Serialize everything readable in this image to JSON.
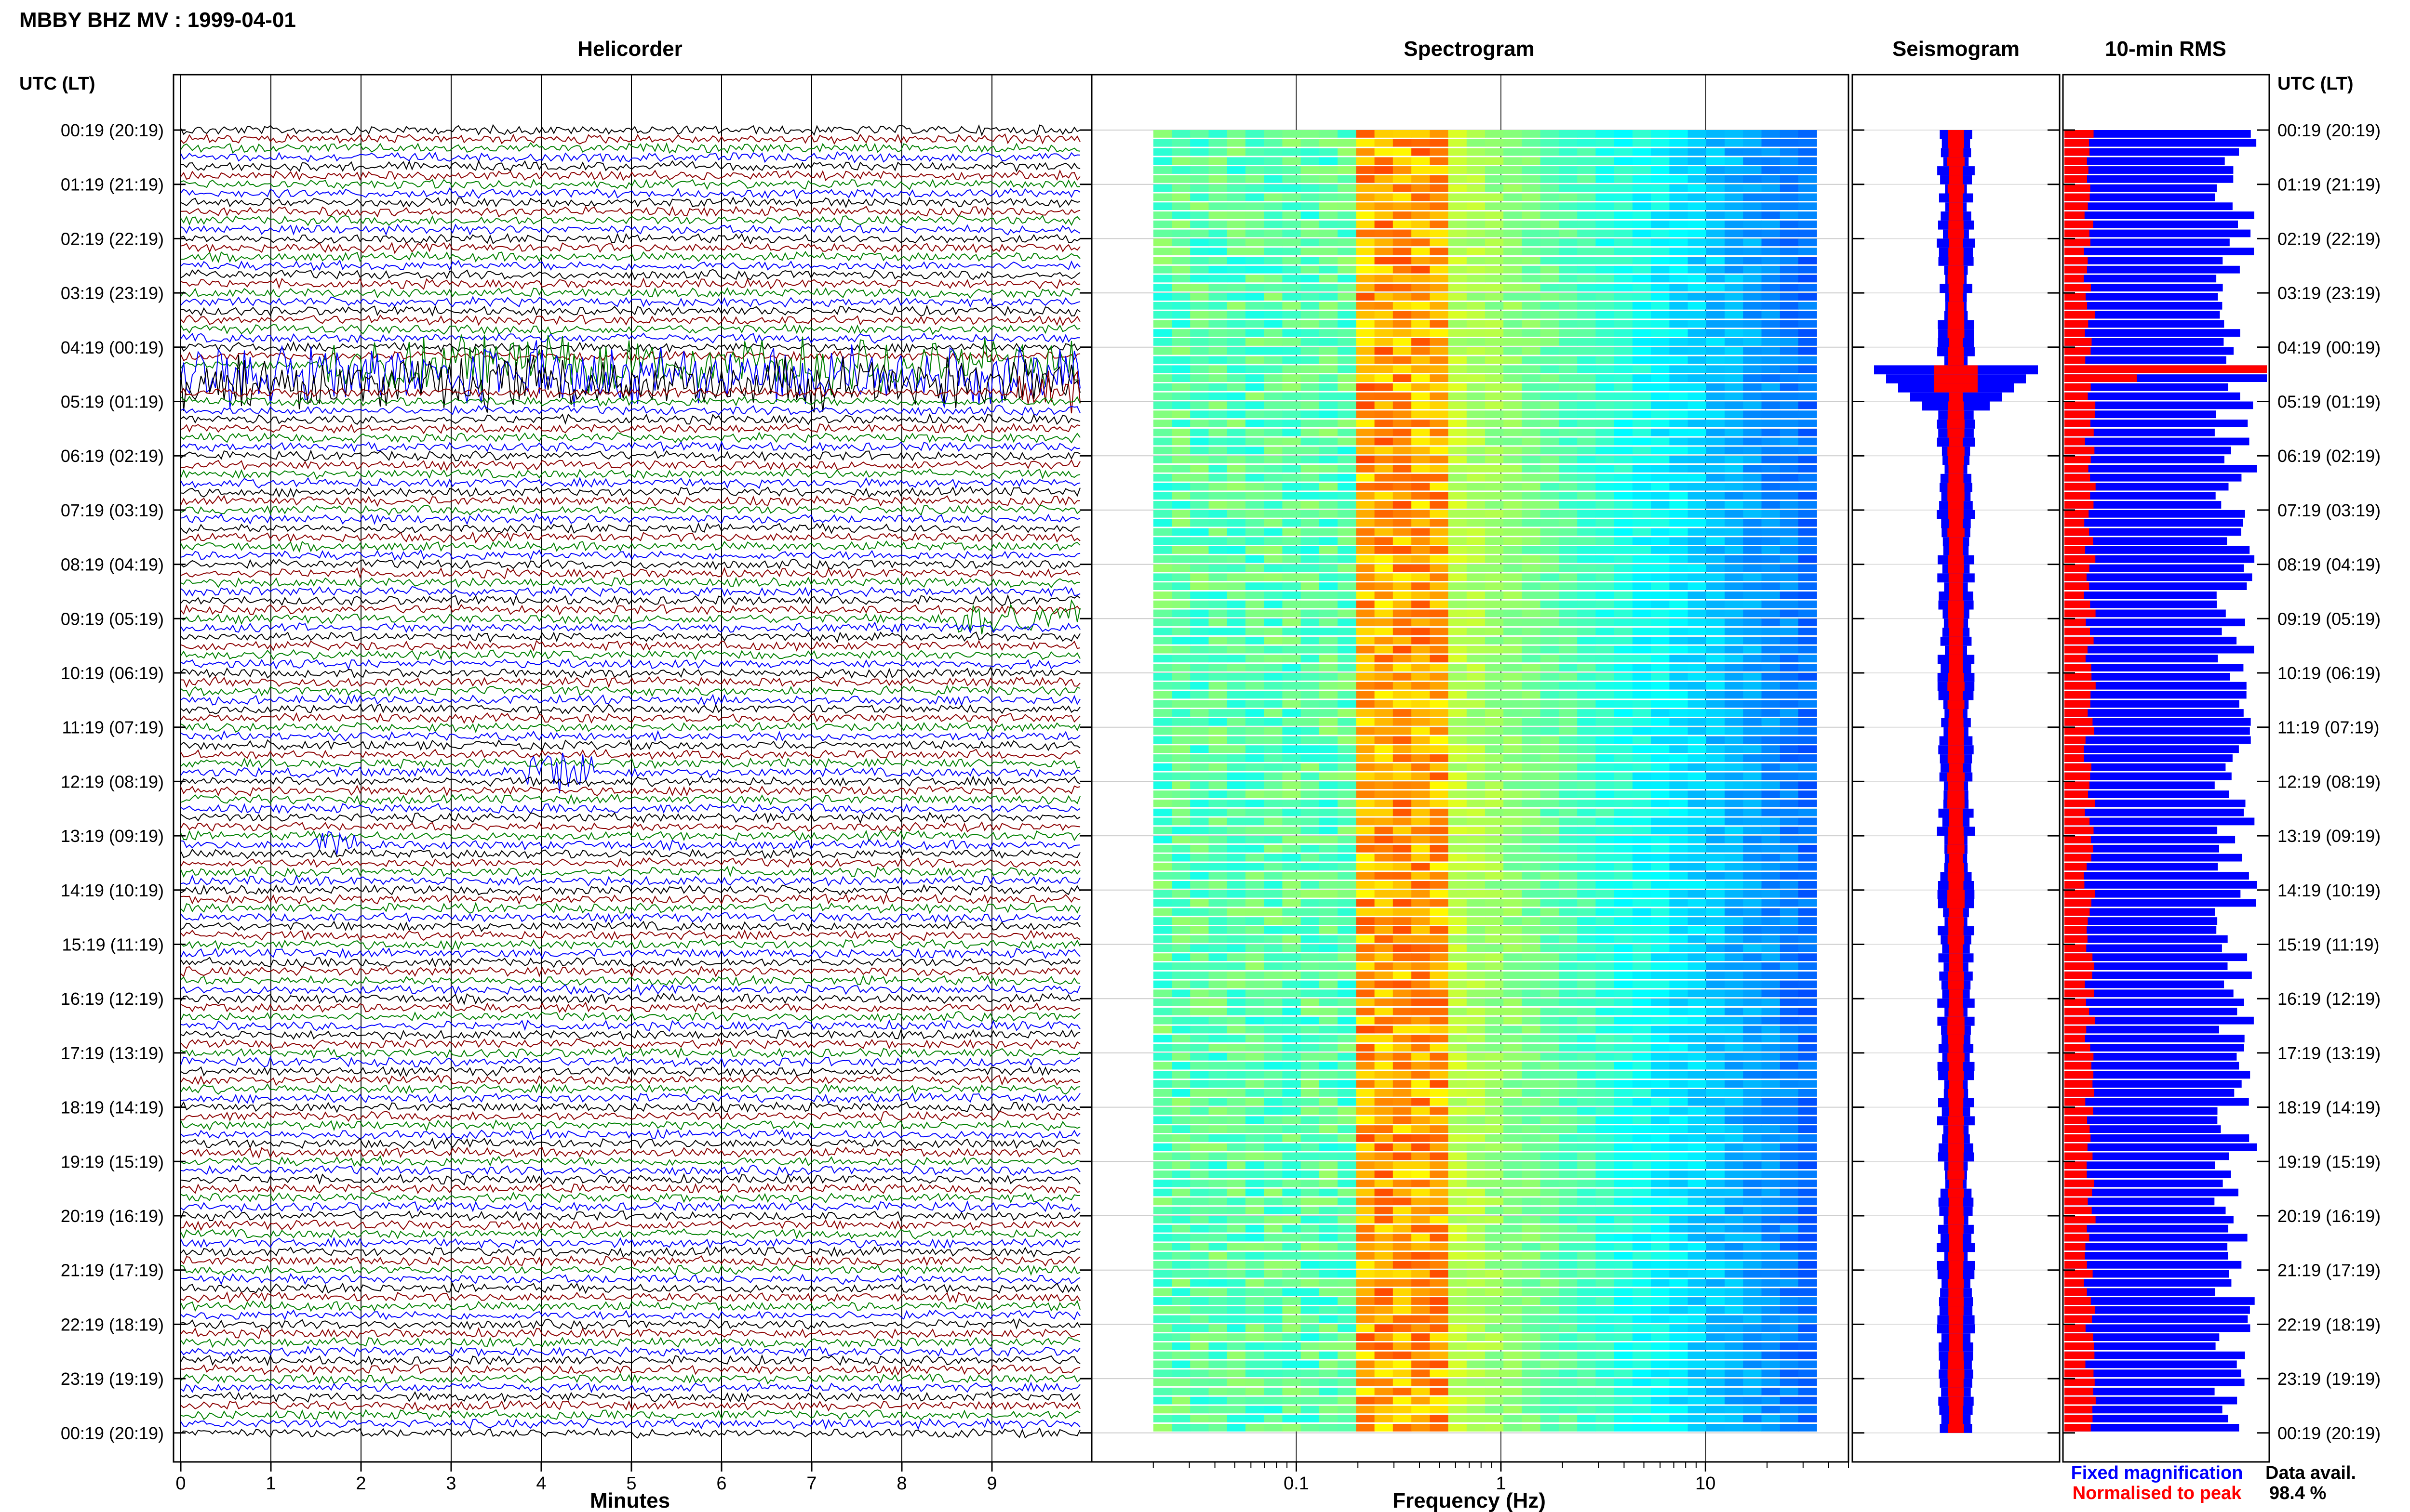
{
  "page_title": "MBBY BHZ MV : 1999-04-01",
  "time_axis_label": "UTC (LT)",
  "row_labels": [
    "00:19 (20:19)",
    "01:19 (21:19)",
    "02:19 (22:19)",
    "03:19 (23:19)",
    "04:19 (00:19)",
    "05:19 (01:19)",
    "06:19 (02:19)",
    "07:19 (03:19)",
    "08:19 (04:19)",
    "09:19 (05:19)",
    "10:19 (06:19)",
    "11:19 (07:19)",
    "12:19 (08:19)",
    "13:19 (09:19)",
    "14:19 (10:19)",
    "15:19 (11:19)",
    "16:19 (12:19)",
    "17:19 (13:19)",
    "18:19 (14:19)",
    "19:19 (15:19)",
    "20:19 (16:19)",
    "21:19 (17:19)",
    "22:19 (18:19)",
    "23:19 (19:19)",
    "00:19 (20:19)"
  ],
  "chart_data": [
    {
      "type": "line",
      "title": "Helicorder",
      "xlabel": "Minutes",
      "x_ticks": [
        0,
        1,
        2,
        3,
        4,
        5,
        6,
        7,
        8,
        9
      ],
      "xlim": [
        0,
        10
      ],
      "trace_colors": [
        "#000000",
        "#8b0000",
        "#008000",
        "#0000ff"
      ],
      "lines_per_hour": 6,
      "events": [
        {
          "row": 26,
          "start_min": 1.6,
          "end_min": 10.0,
          "level": 0.9
        },
        {
          "row": 27,
          "start_min": 0.0,
          "end_min": 10.0,
          "level": 1.0
        },
        {
          "row": 28,
          "start_min": 0.0,
          "end_min": 10.0,
          "level": 0.8
        },
        {
          "row": 29,
          "start_min": 9.3,
          "end_min": 10.0,
          "level": 0.6
        },
        {
          "row": 54,
          "start_min": 8.6,
          "end_min": 10.0,
          "level": 0.6
        },
        {
          "row": 71,
          "start_min": 3.8,
          "end_min": 4.6,
          "level": 0.7
        },
        {
          "row": 79,
          "start_min": 1.5,
          "end_min": 2.0,
          "level": 0.4
        }
      ]
    },
    {
      "type": "heatmap",
      "title": "Spectrogram",
      "xlabel": "Frequency (Hz)",
      "x_scale": "log",
      "xlim": [
        0.01,
        50
      ],
      "x_tick_labels": [
        {
          "value": 0.1,
          "label": "0.1"
        },
        {
          "value": 1,
          "label": "1"
        },
        {
          "value": 10,
          "label": "10"
        }
      ],
      "dominant_band_hz": [
        0.2,
        0.5
      ]
    },
    {
      "type": "line",
      "title": "Seismogram",
      "series": [
        {
          "name": "Fixed magnification",
          "color": "#0000ff"
        },
        {
          "name": "Normalised to peak",
          "color": "#ff0000"
        }
      ]
    },
    {
      "type": "bar",
      "title": "10-min RMS",
      "colors": {
        "fixed": "#0000ff",
        "normalised": "#ff0000"
      }
    }
  ],
  "legend": {
    "fixed_label": "Fixed magnification",
    "normalised_label": "Normalised to peak",
    "availability_label": "Data avail.",
    "availability_value": "98.4 %"
  }
}
